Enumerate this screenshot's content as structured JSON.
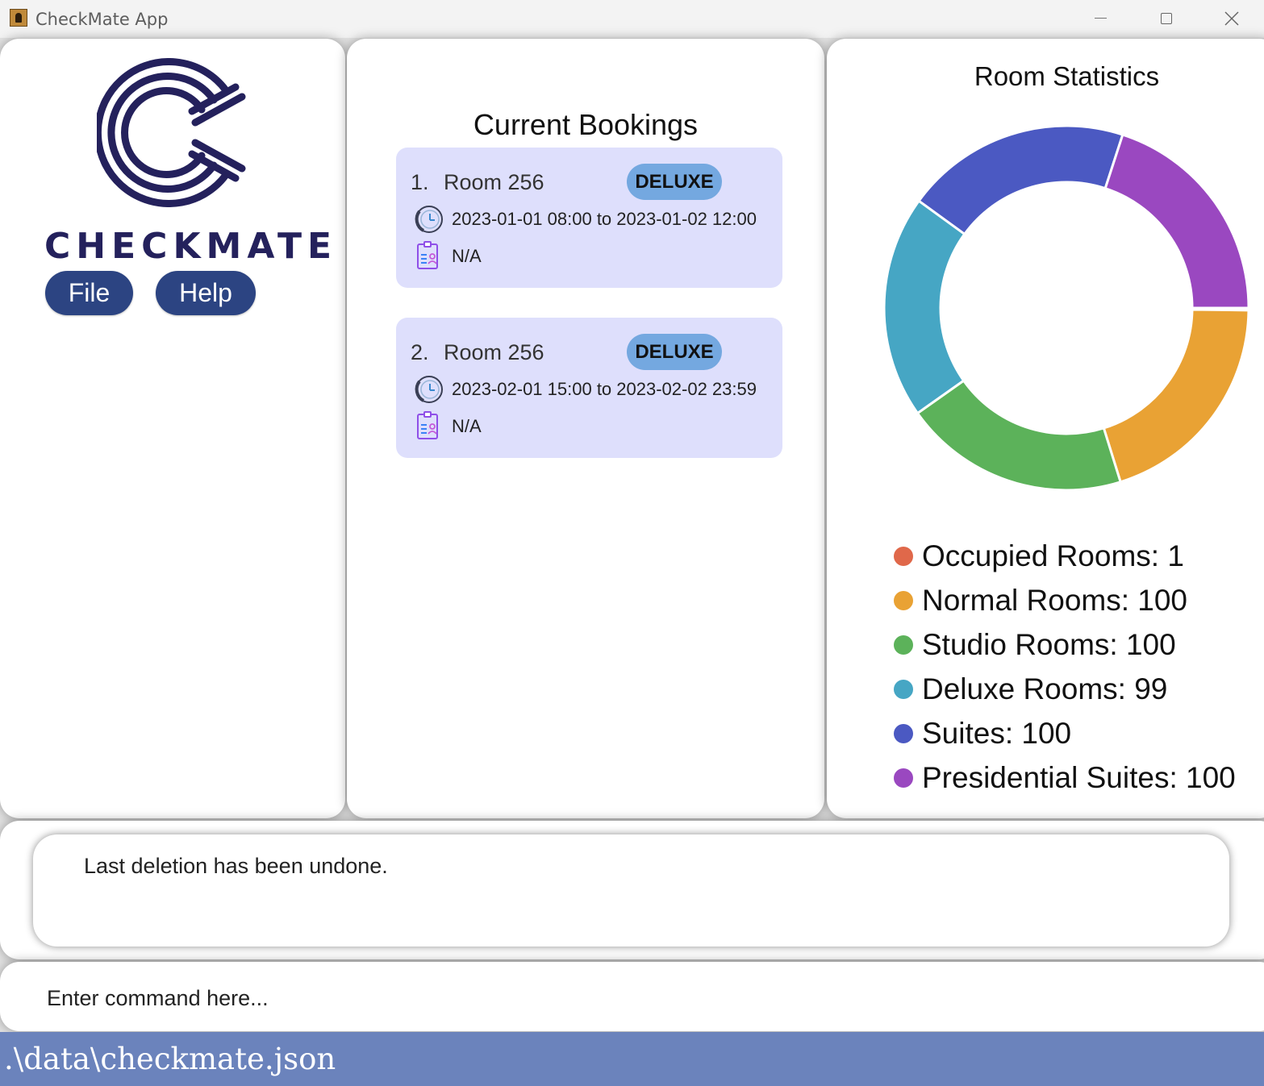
{
  "window": {
    "title": "CheckMate App",
    "icons": [
      "app-icon",
      "minimize-icon",
      "maximize-icon",
      "close-icon"
    ]
  },
  "sidebar": {
    "logo_text": "CHECKMATE",
    "menu": [
      {
        "label": "File"
      },
      {
        "label": "Help"
      }
    ],
    "colors": {
      "logo": "#24215c",
      "menu_button": "#2c4482"
    }
  },
  "bookings": {
    "title": "Current Bookings",
    "items": [
      {
        "index": "1.",
        "room": "Room 256",
        "type": "DELUXE",
        "time": "2023-01-01 08:00 to 2023-01-02 12:00",
        "note": "N/A"
      },
      {
        "index": "2.",
        "room": "Room 256",
        "type": "DELUXE",
        "time": "2023-02-01 15:00 to 2023-02-02 23:59",
        "note": "N/A"
      }
    ],
    "colors": {
      "card": "#dedffc",
      "badge": "#74a8e0"
    }
  },
  "stats": {
    "title": "Room Statistics",
    "legend": [
      {
        "label": "Occupied Rooms: 1",
        "color": "#e0684a"
      },
      {
        "label": "Normal Rooms: 100",
        "color": "#e9a234"
      },
      {
        "label": "Studio Rooms: 100",
        "color": "#5cb25a"
      },
      {
        "label": "Deluxe Rooms: 99",
        "color": "#46a6c4"
      },
      {
        "label": "Suites: 100",
        "color": "#4b59c2"
      },
      {
        "label": "Presidential Suites: 100",
        "color": "#9a48c0"
      }
    ]
  },
  "chart_data": {
    "type": "pie",
    "title": "Room Statistics",
    "categories": [
      "Occupied Rooms",
      "Normal Rooms",
      "Studio Rooms",
      "Deluxe Rooms",
      "Suites",
      "Presidential Suites"
    ],
    "values": [
      1,
      100,
      100,
      99,
      100,
      100
    ],
    "colors": [
      "#e0684a",
      "#e9a234",
      "#5cb25a",
      "#46a6c4",
      "#4b59c2",
      "#9a48c0"
    ],
    "legend": "bottom"
  },
  "result": {
    "text": "Last deletion has been undone."
  },
  "command": {
    "placeholder": "Enter command here...",
    "value": ""
  },
  "status": {
    "path": ".\\data\\checkmate.json",
    "color": "#6b83bc"
  }
}
